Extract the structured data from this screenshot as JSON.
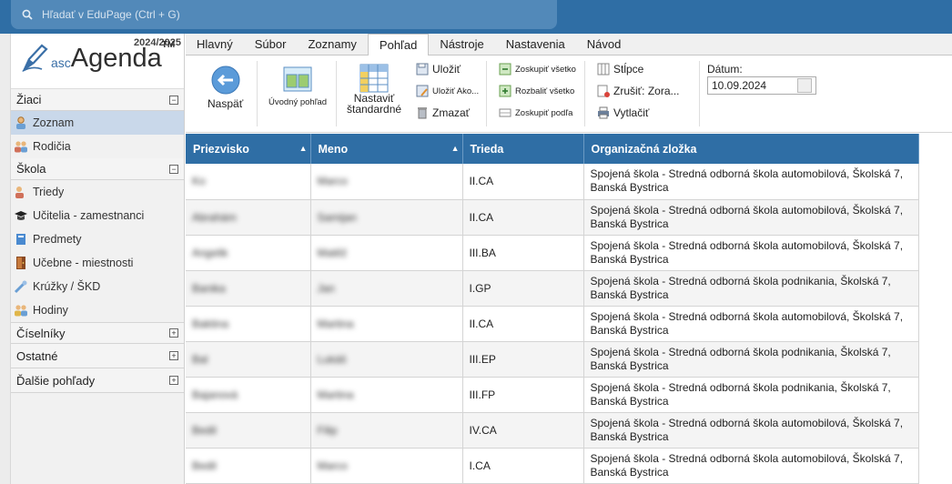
{
  "search": {
    "placeholder": "Hľadať v EduPage (Ctrl + G)"
  },
  "app": {
    "year": "2024/2025",
    "logo_asc": "asc",
    "logo_agenda": "Agenda",
    "logo_tm": "TM"
  },
  "sidebar": {
    "sections": [
      {
        "label": "Žiaci",
        "toggle": "−"
      },
      {
        "label": "Škola",
        "toggle": "−"
      },
      {
        "label": "Číselníky",
        "toggle": "+"
      },
      {
        "label": "Ostatné",
        "toggle": "+"
      },
      {
        "label": "Ďalšie pohľady",
        "toggle": "+"
      }
    ],
    "items": [
      {
        "label": "Zoznam"
      },
      {
        "label": "Rodičia"
      },
      {
        "label": "Triedy"
      },
      {
        "label": "Učitelia - zamestnanci"
      },
      {
        "label": "Predmety"
      },
      {
        "label": "Učebne - miestnosti"
      },
      {
        "label": "Krúžky / ŠKD"
      },
      {
        "label": "Hodiny"
      }
    ]
  },
  "tabs": [
    "Hlavný",
    "Súbor",
    "Zoznamy",
    "Pohľad",
    "Nástroje",
    "Nastavenia",
    "Návod"
  ],
  "ribbon": {
    "back": "Naspäť",
    "default_view": "Úvodný pohľad",
    "set_default_1": "Nastaviť",
    "set_default_2": "štandardné",
    "save": "Uložiť",
    "save_as": "Uložiť Ako...",
    "delete": "Zmazať",
    "group_all": "Zoskupiť všetko",
    "expand_all": "Rozbaliť všetko",
    "group_by": "Zoskupiť podľa",
    "columns": "Stĺpce",
    "cancel_sort": "Zrušiť: Zora...",
    "print": "Vytlačiť",
    "date_label": "Dátum:",
    "date_value": "10.09.2024"
  },
  "table": {
    "headers": [
      "Priezvisko",
      "Meno",
      "Trieda",
      "Organizačná zložka"
    ],
    "rows": [
      {
        "surname": "Ko",
        "name": "Marco",
        "class": "II.CA",
        "org1": "Spojená škola - Stredná odborná škola automobilová, Školská 7,",
        "org2": "Banská Bystrica"
      },
      {
        "surname": "Abrahám",
        "name": "Samijan",
        "class": "II.CA",
        "org1": "Spojená škola - Stredná odborná škola automobilová, Školská 7,",
        "org2": "Banská Bystrica"
      },
      {
        "surname": "Angelik",
        "name": "Matěž",
        "class": "III.BA",
        "org1": "Spojená škola - Stredná odborná škola automobilová, Školská 7,",
        "org2": "Banská Bystrica"
      },
      {
        "surname": "Banika",
        "name": "Jan",
        "class": "I.GP",
        "org1": "Spojená škola - Stredná odborná škola podnikania, Školská 7,",
        "org2": "Banská Bystrica"
      },
      {
        "surname": "Baktina",
        "name": "Martina",
        "class": "II.CA",
        "org1": "Spojená škola - Stredná odborná škola automobilová, Školská 7,",
        "org2": "Banská Bystrica"
      },
      {
        "surname": "Bal",
        "name": "Lukáš",
        "class": "III.EP",
        "org1": "Spojená škola - Stredná odborná škola podnikania, Školská 7,",
        "org2": "Banská Bystrica"
      },
      {
        "surname": "Bajanová",
        "name": "Martina",
        "class": "III.FP",
        "org1": "Spojená škola - Stredná odborná škola podnikania, Školská 7,",
        "org2": "Banská Bystrica"
      },
      {
        "surname": "Bedil",
        "name": "Filip",
        "class": "IV.CA",
        "org1": "Spojená škola - Stredná odborná škola automobilová, Školská 7,",
        "org2": "Banská Bystrica"
      },
      {
        "surname": "Bedil",
        "name": "Marco",
        "class": "I.CA",
        "org1": "Spojená škola - Stredná odborná škola automobilová, Školská 7,",
        "org2": "Banská Bystrica"
      }
    ]
  }
}
